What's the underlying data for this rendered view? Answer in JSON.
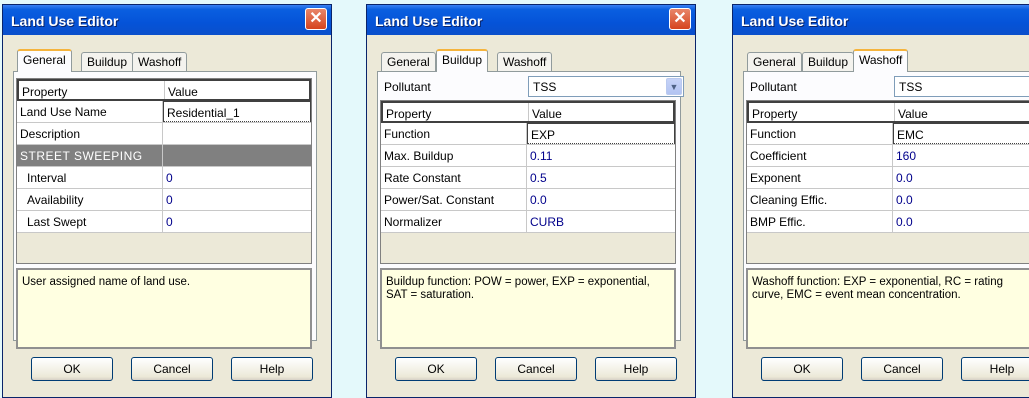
{
  "dialogs": [
    {
      "title": "Land Use Editor",
      "tabs": [
        "General",
        "Buildup",
        "Washoff"
      ],
      "active_tab": "General",
      "table": {
        "header": [
          "Property",
          "Value"
        ],
        "rows": [
          {
            "property": "Land Use Name",
            "value": "Residential_1"
          },
          {
            "property": "Description",
            "value": ""
          },
          {
            "property": "STREET SWEEPING",
            "value": ""
          },
          {
            "property": "Interval",
            "value": "0"
          },
          {
            "property": "Availability",
            "value": "0"
          },
          {
            "property": "Last Swept",
            "value": "0"
          }
        ]
      },
      "description": "User assigned name of land use.",
      "buttons": {
        "ok": "OK",
        "cancel": "Cancel",
        "help": "Help"
      }
    },
    {
      "title": "Land Use Editor",
      "tabs": [
        "General",
        "Buildup",
        "Washoff"
      ],
      "active_tab": "Buildup",
      "pollutant_label": "Pollutant",
      "pollutant_value": "TSS",
      "table": {
        "header": [
          "Property",
          "Value"
        ],
        "rows": [
          {
            "property": "Function",
            "value": "EXP"
          },
          {
            "property": "Max. Buildup",
            "value": "0.11"
          },
          {
            "property": "Rate Constant",
            "value": "0.5"
          },
          {
            "property": "Power/Sat. Constant",
            "value": "0.0"
          },
          {
            "property": "Normalizer",
            "value": "CURB"
          }
        ]
      },
      "description": "Buildup function: POW = power, EXP = exponential, SAT = saturation.",
      "buttons": {
        "ok": "OK",
        "cancel": "Cancel",
        "help": "Help"
      }
    },
    {
      "title": "Land Use Editor",
      "tabs": [
        "General",
        "Buildup",
        "Washoff"
      ],
      "active_tab": "Washoff",
      "pollutant_label": "Pollutant",
      "pollutant_value": "TSS",
      "table": {
        "header": [
          "Property",
          "Value"
        ],
        "rows": [
          {
            "property": "Function",
            "value": "EMC"
          },
          {
            "property": "Coefficient",
            "value": "160"
          },
          {
            "property": "Exponent",
            "value": "0.0"
          },
          {
            "property": "Cleaning Effic.",
            "value": "0.0"
          },
          {
            "property": "BMP Effic.",
            "value": "0.0"
          }
        ]
      },
      "description": "Washoff function: EXP = exponential, RC = rating curve, EMC = event mean concentration.",
      "buttons": {
        "ok": "OK",
        "cancel": "Cancel",
        "help": "Help"
      }
    }
  ],
  "close_glyph": "✕",
  "dropdown_glyph": "▼",
  "colors": {
    "background": "#e4f9fb",
    "titlebar": "#0553d8",
    "value_text": "#00008b",
    "section_row": "#808080",
    "description_bg": "#ffffe1"
  }
}
